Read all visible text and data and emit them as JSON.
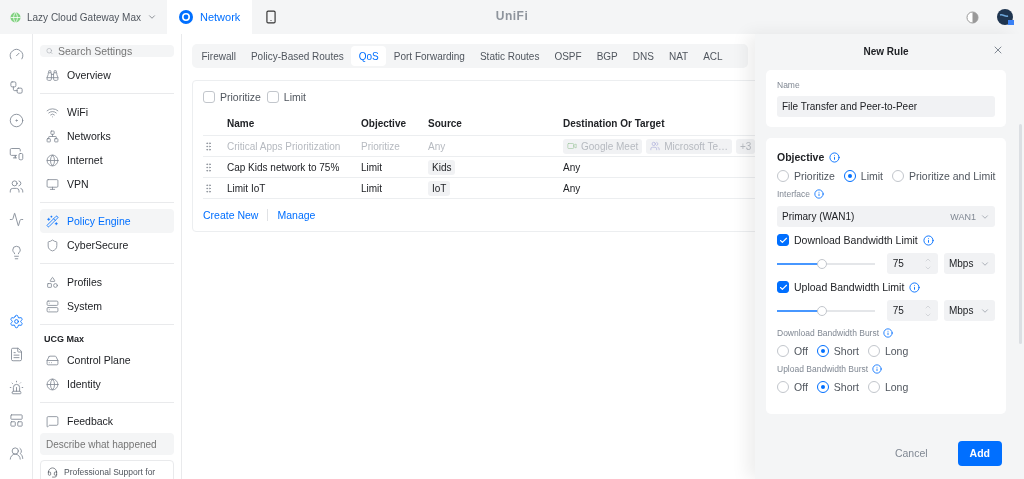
{
  "top_bar": {
    "site": {
      "name": "Lazy Cloud Gateway Max"
    },
    "app_tabs": [
      {
        "label": "Network",
        "kind": "app"
      },
      {
        "kind": "device"
      }
    ],
    "logo": "UniFi"
  },
  "rail": [
    {
      "selected": false
    },
    {
      "selected": false
    },
    {
      "selected": false
    },
    {
      "selected": false
    },
    {
      "selected": false
    },
    {
      "selected": false
    },
    {
      "selected": false
    },
    {
      "selected": true
    },
    {
      "selected": false
    },
    {
      "selected": false
    },
    {
      "selected": false
    },
    {
      "selected": false
    }
  ],
  "sidebar": {
    "search": {
      "placeholder": "Search Settings"
    },
    "sections": [
      {
        "items": [
          {
            "label": "Overview",
            "selected": false
          }
        ]
      },
      {
        "items": [
          {
            "label": "WiFi",
            "selected": false
          },
          {
            "label": "Networks",
            "selected": false
          },
          {
            "label": "Internet",
            "selected": false
          },
          {
            "label": "VPN",
            "selected": false
          }
        ]
      },
      {
        "items": [
          {
            "label": "Policy Engine",
            "selected": true
          },
          {
            "label": "CyberSecure",
            "selected": false
          }
        ]
      },
      {
        "items": [
          {
            "label": "Profiles",
            "selected": false
          },
          {
            "label": "System",
            "selected": false
          }
        ]
      },
      {
        "heading": "UCG Max",
        "items": [
          {
            "label": "Control Plane",
            "selected": false
          },
          {
            "label": "Identity",
            "selected": false
          }
        ]
      }
    ],
    "feedback": {
      "label": "Feedback",
      "placeholder": "Describe what happened"
    },
    "support": "Professional Support for"
  },
  "tabs": [
    {
      "label": "Firewall",
      "selected": false
    },
    {
      "label": "Policy-Based Routes",
      "selected": false
    },
    {
      "label": "QoS",
      "selected": true
    },
    {
      "label": "Port Forwarding",
      "selected": false
    },
    {
      "label": "Static Routes",
      "selected": false
    },
    {
      "label": "OSPF",
      "selected": false
    },
    {
      "label": "BGP",
      "selected": false
    },
    {
      "label": "DNS",
      "selected": false
    },
    {
      "label": "NAT",
      "selected": false
    },
    {
      "label": "ACL",
      "selected": false
    }
  ],
  "filters": [
    {
      "label": "Prioritize",
      "checked": false
    },
    {
      "label": "Limit",
      "checked": false
    }
  ],
  "table": {
    "columns": [
      "Name",
      "Objective",
      "Source",
      "Destination Or Target"
    ],
    "rows": [
      {
        "disabled": true,
        "name": "Critical Apps Prioritization",
        "objective": "Prioritize",
        "source": {
          "text": "Any",
          "tag": false
        },
        "destination": [
          {
            "text": "Google Meet",
            "kind": "meet"
          },
          {
            "text": "Microsoft Te…",
            "kind": "teams"
          },
          {
            "text": "+3",
            "kind": "count"
          }
        ]
      },
      {
        "disabled": false,
        "name": "Cap Kids network to 75%",
        "objective": "Limit",
        "source": {
          "text": "Kids",
          "tag": true
        },
        "destination": [
          {
            "text": "Any",
            "kind": "plain"
          }
        ]
      },
      {
        "disabled": false,
        "name": "Limit IoT",
        "objective": "Limit",
        "source": {
          "text": "IoT",
          "tag": true
        },
        "destination": [
          {
            "text": "Any",
            "kind": "plain"
          }
        ]
      }
    ]
  },
  "actions": [
    "Create New",
    "Manage"
  ],
  "drawer": {
    "title": "New Rule",
    "name": {
      "label": "Name",
      "value": "File Transfer and Peer-to-Peer"
    },
    "objective": {
      "heading": "Objective",
      "options": [
        {
          "label": "Prioritize",
          "selected": false
        },
        {
          "label": "Limit",
          "selected": true
        },
        {
          "label": "Prioritize and Limit",
          "selected": false
        }
      ]
    },
    "interface": {
      "label": "Interface",
      "value": "Primary (WAN1)",
      "tag": "WAN1"
    },
    "limits": [
      {
        "label": "Download Bandwidth Limit",
        "checked": true,
        "level": 0.46,
        "value": "75",
        "unit": "Mbps"
      },
      {
        "label": "Upload Bandwidth Limit",
        "checked": true,
        "level": 0.46,
        "value": "75",
        "unit": "Mbps"
      }
    ],
    "bursts": [
      {
        "label": "Download Bandwidth Burst",
        "options": [
          {
            "label": "Off",
            "selected": false
          },
          {
            "label": "Short",
            "selected": true
          },
          {
            "label": "Long",
            "selected": false
          }
        ]
      },
      {
        "label": "Upload Bandwidth Burst",
        "options": [
          {
            "label": "Off",
            "selected": false
          },
          {
            "label": "Short",
            "selected": true
          },
          {
            "label": "Long",
            "selected": false
          }
        ]
      }
    ],
    "buttons": [
      {
        "label": "Cancel",
        "kind": "secondary"
      },
      {
        "label": "Add",
        "kind": "primary"
      }
    ]
  }
}
